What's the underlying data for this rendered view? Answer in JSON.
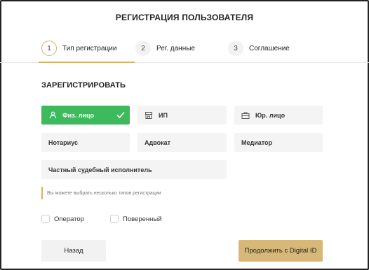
{
  "page_title": "РЕГИСТРАЦИЯ ПОЛЬЗОВАТЕЛЯ",
  "steps": [
    {
      "num": "1",
      "label": "Тип регистрации"
    },
    {
      "num": "2",
      "label": "Рег. данные"
    },
    {
      "num": "3",
      "label": "Соглашение"
    }
  ],
  "section_title": "ЗАРЕГИСТРИРОВАТЬ",
  "options": {
    "individual": "Физ. лицо",
    "ip": "ИП",
    "legal": "Юр. лицо",
    "notary": "Нотариус",
    "lawyer": "Адвокат",
    "mediator": "Медиатор",
    "bailiff": "Частный судебный исполнитель"
  },
  "hint": "Вы можете выбрать несколько типов регистрации",
  "checkboxes": {
    "operator": "Оператор",
    "attorney": "Поверенный"
  },
  "buttons": {
    "back": "Назад",
    "next": "Продолжить с Digital ID"
  },
  "colors": {
    "accent_gold": "#d4b26a",
    "selected_green": "#3dbb5c"
  }
}
